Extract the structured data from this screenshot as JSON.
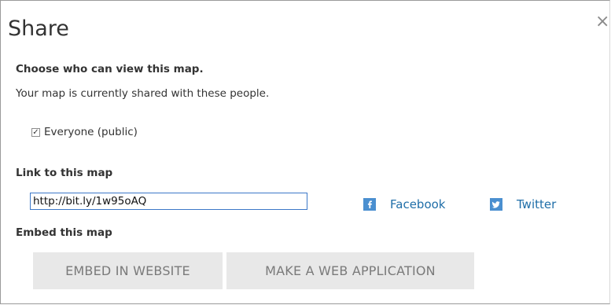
{
  "dialog": {
    "title": "Share",
    "close_glyph": "×"
  },
  "view_section": {
    "heading": "Choose who can view this map.",
    "description": "Your map is currently shared with these people.",
    "everyone_label": "Everyone (public)",
    "everyone_checked": true
  },
  "link_section": {
    "heading": "Link to this map",
    "url_value": "http://bit.ly/1w95oAQ",
    "facebook_label": "Facebook",
    "facebook_icon": "facebook-icon",
    "twitter_label": "Twitter",
    "twitter_icon": "twitter-icon"
  },
  "embed_section": {
    "heading": "Embed this map",
    "embed_button": "EMBED IN WEBSITE",
    "webapp_button": "MAKE A WEB APPLICATION"
  },
  "colors": {
    "link": "#1f6ea8",
    "social_icon_bg": "#4a8fd0",
    "input_border": "#3c78c8",
    "button_bg": "#e8e8e8"
  }
}
